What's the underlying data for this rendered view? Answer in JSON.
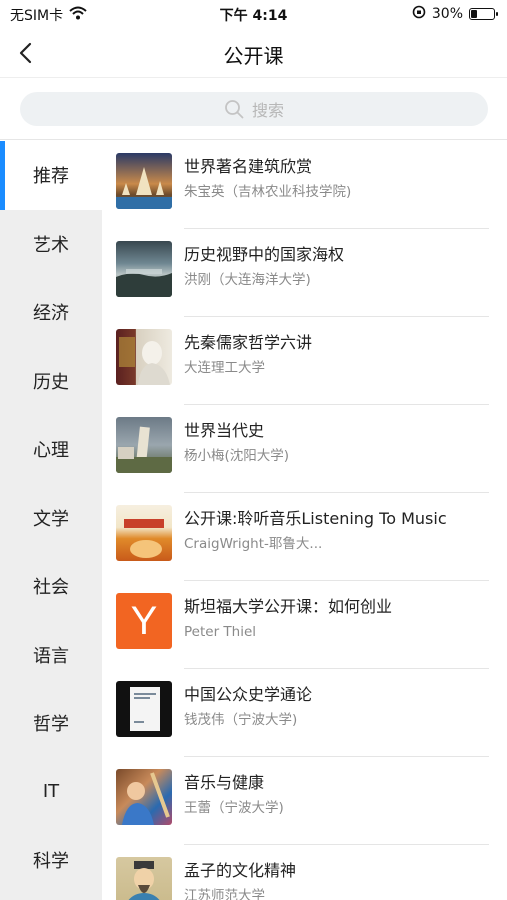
{
  "status_bar": {
    "carrier": "无SIM卡",
    "time": "下午 4:14",
    "battery_text": "30%",
    "battery_level": 0.3
  },
  "nav": {
    "title": "公开课"
  },
  "search": {
    "placeholder": "搜索"
  },
  "sidebar": {
    "items": [
      {
        "label": "推荐",
        "active": true
      },
      {
        "label": "艺术"
      },
      {
        "label": "经济"
      },
      {
        "label": "历史"
      },
      {
        "label": "心理"
      },
      {
        "label": "文学"
      },
      {
        "label": "社会"
      },
      {
        "label": "语言"
      },
      {
        "label": "哲学"
      },
      {
        "label": "IT"
      },
      {
        "label": "科学"
      }
    ]
  },
  "courses": [
    {
      "title": "世界著名建筑欣赏",
      "subtitle": "朱宝英（吉林农业科技学院)"
    },
    {
      "title": "历史视野中的国家海权",
      "subtitle": "洪刚（大连海洋大学)"
    },
    {
      "title": "先秦儒家哲学六讲",
      "subtitle": "大连理工大学"
    },
    {
      "title": "世界当代史",
      "subtitle": "杨小梅(沈阳大学)"
    },
    {
      "title": "公开课:聆听音乐Listening To Music",
      "subtitle": "CraigWright-耶鲁大..."
    },
    {
      "title": "斯坦福大学公开课：如何创业",
      "subtitle": "Peter Thiel"
    },
    {
      "title": "中国公众史学通论",
      "subtitle": "钱茂伟（宁波大学)"
    },
    {
      "title": "音乐与健康",
      "subtitle": "王蕾（宁波大学)"
    },
    {
      "title": "孟子的文化精神",
      "subtitle": "江苏师范大学"
    }
  ],
  "thumb_text": {
    "ycombinator_logo": "Y"
  }
}
